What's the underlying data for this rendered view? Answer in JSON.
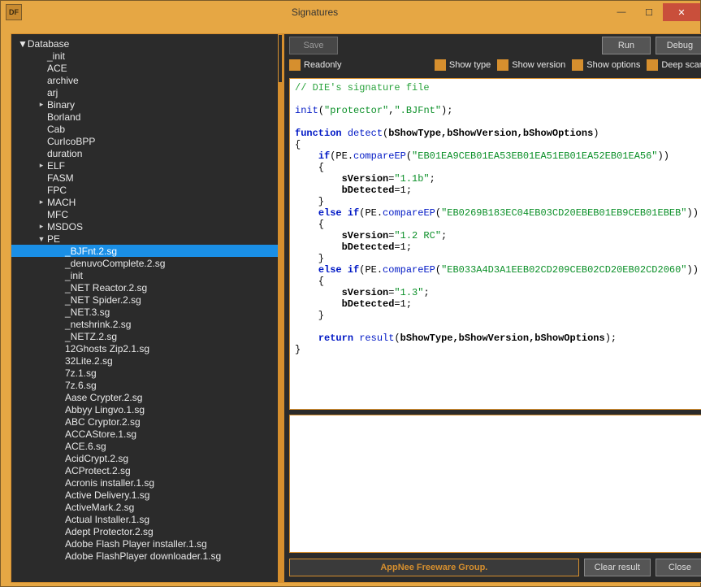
{
  "window": {
    "title": "Signatures",
    "app_icon_text": "DF"
  },
  "toolbar": {
    "save": "Save",
    "run": "Run",
    "debug": "Debug"
  },
  "options": {
    "readonly": "Readonly",
    "show_type": "Show type",
    "show_version": "Show version",
    "show_options": "Show options",
    "deep_scan": "Deep scan"
  },
  "tree": {
    "root": "Database",
    "items": [
      {
        "label": "_init",
        "depth": 1
      },
      {
        "label": "ACE",
        "depth": 1
      },
      {
        "label": "archive",
        "depth": 1
      },
      {
        "label": "arj",
        "depth": 1
      },
      {
        "label": "Binary",
        "depth": 1,
        "expandable": true
      },
      {
        "label": "Borland",
        "depth": 1
      },
      {
        "label": "Cab",
        "depth": 1
      },
      {
        "label": "CurIcoBPP",
        "depth": 1
      },
      {
        "label": "duration",
        "depth": 1
      },
      {
        "label": "ELF",
        "depth": 1,
        "expandable": true
      },
      {
        "label": "FASM",
        "depth": 1
      },
      {
        "label": "FPC",
        "depth": 1
      },
      {
        "label": "MACH",
        "depth": 1,
        "expandable": true
      },
      {
        "label": "MFC",
        "depth": 1
      },
      {
        "label": "MSDOS",
        "depth": 1,
        "expandable": true
      },
      {
        "label": "PE",
        "depth": 1,
        "expandable": true,
        "expanded": true
      },
      {
        "label": "_BJFnt.2.sg",
        "depth": 2,
        "selected": true
      },
      {
        "label": "_denuvoComplete.2.sg",
        "depth": 2
      },
      {
        "label": "_init",
        "depth": 2
      },
      {
        "label": "_NET Reactor.2.sg",
        "depth": 2
      },
      {
        "label": "_NET Spider.2.sg",
        "depth": 2
      },
      {
        "label": "_NET.3.sg",
        "depth": 2
      },
      {
        "label": "_netshrink.2.sg",
        "depth": 2
      },
      {
        "label": "_NETZ.2.sg",
        "depth": 2
      },
      {
        "label": "12Ghosts Zip2.1.sg",
        "depth": 2
      },
      {
        "label": "32Lite.2.sg",
        "depth": 2
      },
      {
        "label": "7z.1.sg",
        "depth": 2
      },
      {
        "label": "7z.6.sg",
        "depth": 2
      },
      {
        "label": "Aase Crypter.2.sg",
        "depth": 2
      },
      {
        "label": "Abbyy Lingvo.1.sg",
        "depth": 2
      },
      {
        "label": "ABC Cryptor.2.sg",
        "depth": 2
      },
      {
        "label": "ACCAStore.1.sg",
        "depth": 2
      },
      {
        "label": "ACE.6.sg",
        "depth": 2
      },
      {
        "label": "AcidCrypt.2.sg",
        "depth": 2
      },
      {
        "label": "ACProtect.2.sg",
        "depth": 2
      },
      {
        "label": "Acronis installer.1.sg",
        "depth": 2
      },
      {
        "label": "Active Delivery.1.sg",
        "depth": 2
      },
      {
        "label": "ActiveMark.2.sg",
        "depth": 2
      },
      {
        "label": "Actual Installer.1.sg",
        "depth": 2
      },
      {
        "label": "Adept Protector.2.sg",
        "depth": 2
      },
      {
        "label": "Adobe Flash Player installer.1.sg",
        "depth": 2
      },
      {
        "label": "Adobe FlashPlayer downloader.1.sg",
        "depth": 2
      }
    ]
  },
  "code": {
    "comment": "// DIE's signature file",
    "init_fn": "init",
    "init_arg1": "\"protector\"",
    "init_arg2": "\".BJFnt\"",
    "fn_kw": "function",
    "fn_name": "detect",
    "params": "bShowType,bShowVersion,bShowOptions",
    "if_kw": "if",
    "else_kw": "else",
    "PE": "PE",
    "compareEP": "compareEP",
    "ep1": "\"EB01EA9CEB01EA53EB01EA51EB01EA52EB01EA56\"",
    "ep2": "\"EB0269B183EC04EB03CD20EBEB01EB9CEB01EBEB\"",
    "ep3": "\"EB033A4D3A1EEB02CD209CEB02CD20EB02CD2060\"",
    "sVersion": "sVersion",
    "v1": "\"1.1b\"",
    "v2": "\"1.2 RC\"",
    "v3": "\"1.3\"",
    "bDetected": "bDetected",
    "one": "1",
    "return_kw": "return",
    "result_fn": "result",
    "result_args": "bShowType,bShowVersion,bShowOptions"
  },
  "bottom": {
    "brand": "AppNee Freeware Group.",
    "clear": "Clear result",
    "close": "Close"
  }
}
